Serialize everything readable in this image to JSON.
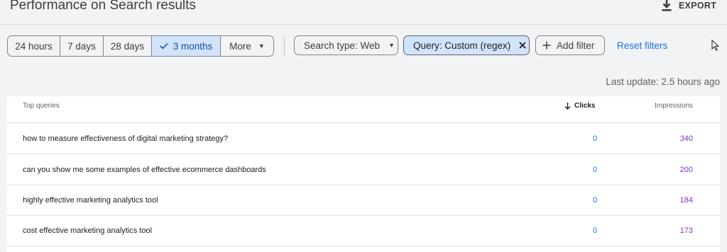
{
  "header": {
    "title": "Performance on Search results",
    "export_label": "EXPORT"
  },
  "date_range": {
    "options": [
      {
        "label": "24 hours",
        "active": false
      },
      {
        "label": "7 days",
        "active": false
      },
      {
        "label": "28 days",
        "active": false
      },
      {
        "label": "3 months",
        "active": true
      }
    ],
    "more_label": "More"
  },
  "filters": {
    "search_type": "Search type: Web",
    "query": "Query: Custom (regex)",
    "add_filter": "Add filter",
    "reset": "Reset filters"
  },
  "last_update": "Last update: 2.5 hours ago",
  "table": {
    "columns": {
      "query": "Top queries",
      "clicks": "Clicks",
      "impressions": "Impressions"
    },
    "sort": {
      "column": "clicks",
      "direction": "descending"
    },
    "rows": [
      {
        "query": "how to measure effectiveness of digital marketing strategy?",
        "clicks": "0",
        "impressions": "340"
      },
      {
        "query": "can you show me some examples of effective ecommerce dashboards",
        "clicks": "0",
        "impressions": "200"
      },
      {
        "query": "highly effective marketing analytics tool",
        "clicks": "0",
        "impressions": "184"
      },
      {
        "query": "cost effective marketing analytics tool",
        "clicks": "0",
        "impressions": "173"
      }
    ]
  },
  "colors": {
    "accent": "#1a73e8",
    "selected_bg": "#d2e3fc",
    "impressions": "#8430ce"
  }
}
